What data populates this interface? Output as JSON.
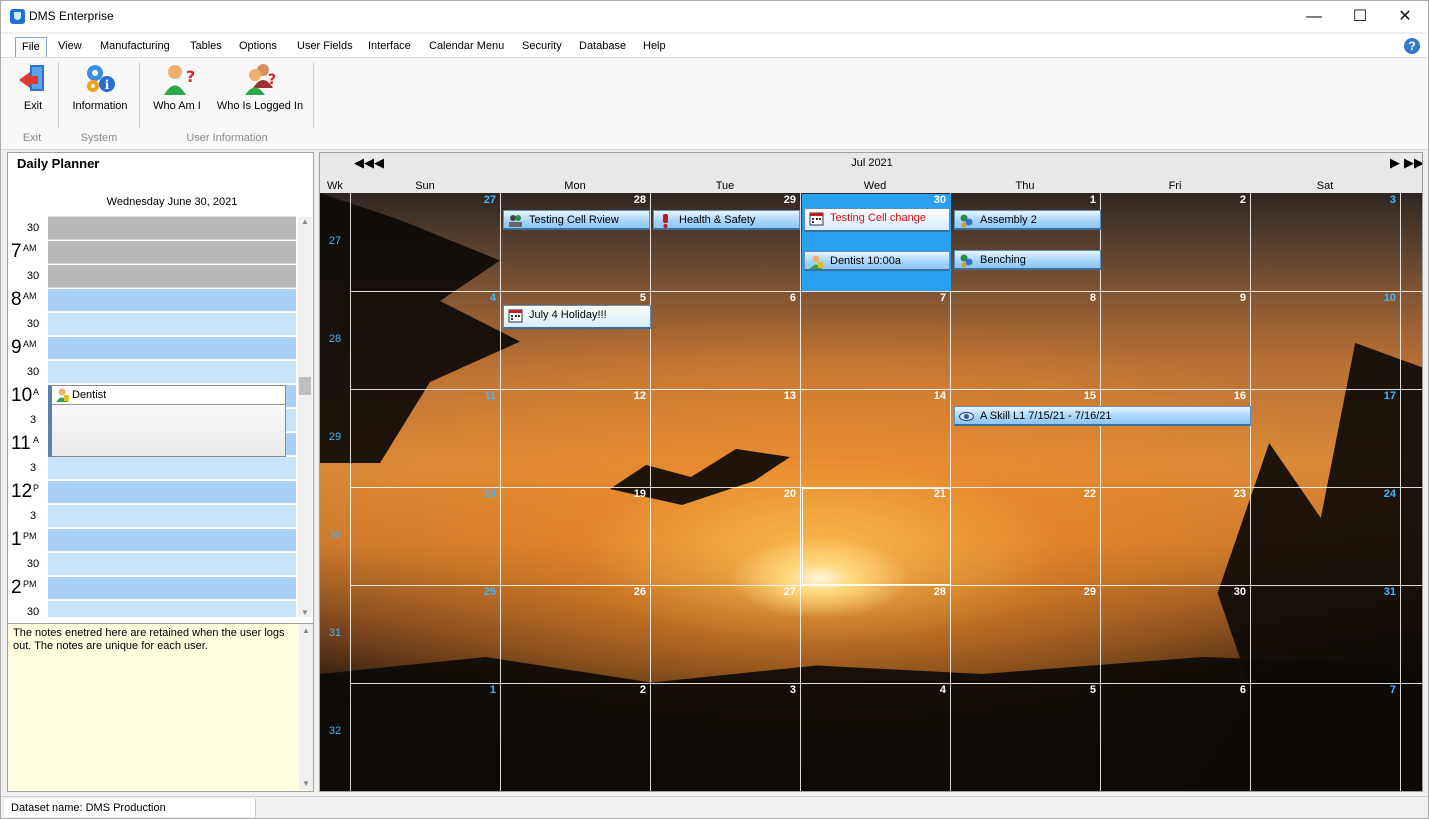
{
  "window": {
    "title": "DMS Enterprise",
    "minimize": "—",
    "maximize": "☐",
    "close": "✕"
  },
  "menu": {
    "items": [
      {
        "label": "File",
        "key": "F"
      },
      {
        "label": "View",
        "key": "V"
      },
      {
        "label": "Manufacturing",
        "key": "M"
      },
      {
        "label": "Tables",
        "key": "T"
      },
      {
        "label": "Options",
        "key": "O"
      },
      {
        "label": "User Fields",
        "key": "U"
      },
      {
        "label": "Interface",
        "key": "I"
      },
      {
        "label": "Calendar Menu",
        "key": "C"
      },
      {
        "label": "Security",
        "key": "S"
      },
      {
        "label": "Database",
        "key": "D"
      },
      {
        "label": "Help",
        "key": "H"
      }
    ],
    "help_icon": "?"
  },
  "ribbon": {
    "exit": "Exit",
    "information": "Information",
    "who_am_i": "Who Am I",
    "who_logged": "Who Is Logged In",
    "groups": {
      "exit": "Exit",
      "system": "System",
      "user_info": "User Information"
    }
  },
  "planner": {
    "title": "Daily Planner",
    "date": "Wednesday June 30, 2021",
    "slots": [
      {
        "hour": "",
        "ampm": "",
        "min": "30",
        "state": "off"
      },
      {
        "hour": "7",
        "ampm": "AM",
        "min": "",
        "state": "off"
      },
      {
        "hour": "",
        "ampm": "",
        "min": "30",
        "state": "off"
      },
      {
        "hour": "8",
        "ampm": "AM",
        "min": "",
        "state": "on"
      },
      {
        "hour": "",
        "ampm": "",
        "min": "30",
        "state": "half"
      },
      {
        "hour": "9",
        "ampm": "AM",
        "min": "",
        "state": "on"
      },
      {
        "hour": "",
        "ampm": "",
        "min": "30",
        "state": "half"
      },
      {
        "hour": "10",
        "ampm": "A",
        "min": "",
        "state": "on"
      },
      {
        "hour": "",
        "ampm": "",
        "min": "3",
        "state": "half"
      },
      {
        "hour": "11",
        "ampm": "A",
        "min": "",
        "state": "on"
      },
      {
        "hour": "",
        "ampm": "",
        "min": "3",
        "state": "half"
      },
      {
        "hour": "12",
        "ampm": "P",
        "min": "",
        "state": "on"
      },
      {
        "hour": "",
        "ampm": "",
        "min": "3",
        "state": "half"
      },
      {
        "hour": "1",
        "ampm": "PM",
        "min": "",
        "state": "on"
      },
      {
        "hour": "",
        "ampm": "",
        "min": "30",
        "state": "half"
      },
      {
        "hour": "2",
        "ampm": "PM",
        "min": "",
        "state": "on"
      },
      {
        "hour": "",
        "ampm": "",
        "min": "30",
        "state": "half"
      }
    ],
    "appointment": "Dentist",
    "notes": "The notes enetred here are retained when the user logs out.  The notes are unique for each user."
  },
  "calendar": {
    "month": "Jul 2021",
    "wk_label": "Wk",
    "days": [
      "Sun",
      "Mon",
      "Tue",
      "Wed",
      "Thu",
      "Fri",
      "Sat"
    ],
    "weeks": [
      {
        "wk": "27",
        "dates": [
          "27",
          "28",
          "29",
          "30",
          "1",
          "2",
          "3"
        ]
      },
      {
        "wk": "28",
        "dates": [
          "4",
          "5",
          "6",
          "7",
          "8",
          "9",
          "10"
        ]
      },
      {
        "wk": "29",
        "dates": [
          "11",
          "12",
          "13",
          "14",
          "15",
          "16",
          "17"
        ]
      },
      {
        "wk": "30",
        "dates": [
          "18",
          "19",
          "20",
          "21",
          "22",
          "23",
          "24"
        ]
      },
      {
        "wk": "31",
        "dates": [
          "25",
          "26",
          "27",
          "28",
          "29",
          "30",
          "31"
        ]
      },
      {
        "wk": "32",
        "dates": [
          "1",
          "2",
          "3",
          "4",
          "5",
          "6",
          "7"
        ]
      }
    ],
    "events": {
      "testing_cell_review": "Testing Cell Rview",
      "health_safety": "Health & Safety",
      "testing_cell_change": "Testing Cell change",
      "assembly": "Assembly 2",
      "dentist": "Dentist 10:00a",
      "benching": "Benching",
      "holiday": "July 4 Holiday!!!",
      "skill": "A Skill L1  7/15/21 - 7/16/21"
    },
    "colors": {
      "weekend": "#3fb7ff",
      "today": "#2aa0f0",
      "event_red": "#d01010"
    }
  },
  "status": {
    "dataset": "Dataset name:  DMS Production"
  }
}
